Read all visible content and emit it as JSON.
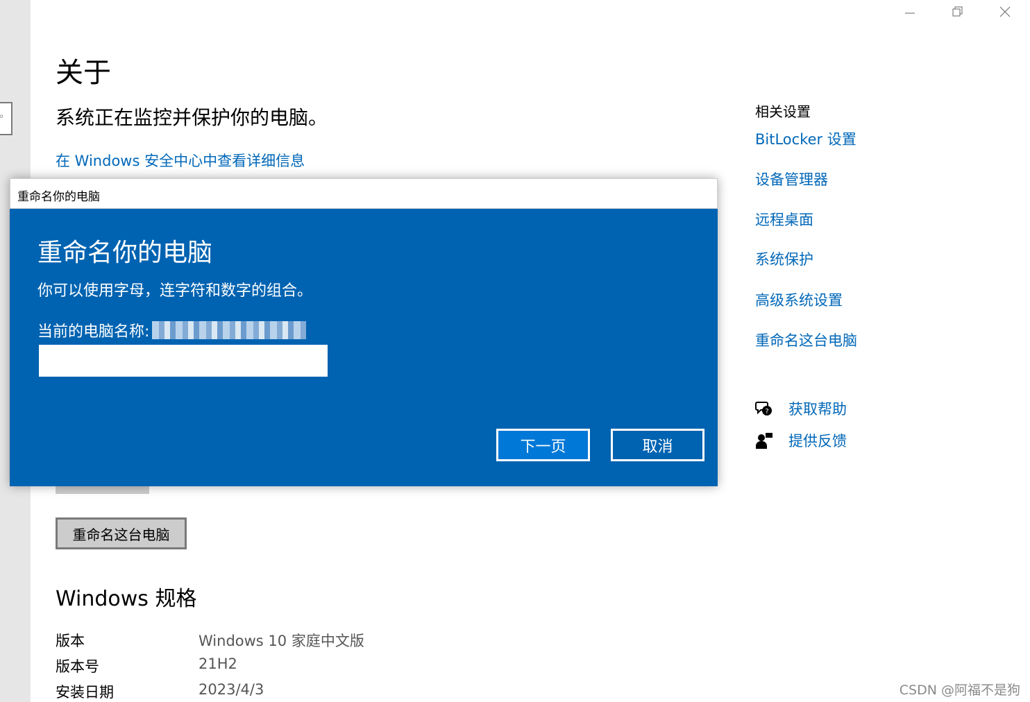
{
  "window_controls": {
    "minimize": "minimize-icon",
    "restore": "restore-icon",
    "close": "close-icon"
  },
  "page": {
    "title": "关于",
    "protect_text": "系统正在监控并保护你的电脑。",
    "security_link": "在 Windows 安全中心中查看详细信息",
    "rename_button": "重命名这台电脑"
  },
  "specs": {
    "title": "Windows 规格",
    "rows": [
      {
        "label": "版本",
        "value": "Windows 10 家庭中文版"
      },
      {
        "label": "版本号",
        "value": "21H2"
      },
      {
        "label": "安装日期",
        "value": "2023/4/3"
      }
    ]
  },
  "related": {
    "title": "相关设置",
    "links": [
      "BitLocker 设置",
      "设备管理器",
      "远程桌面",
      "系统保护",
      "高级系统设置",
      "重命名这台电脑"
    ]
  },
  "help": {
    "get_help": "获取帮助",
    "feedback": "提供反馈"
  },
  "dialog": {
    "window_title": "重命名你的电脑",
    "heading": "重命名你的电脑",
    "hint": "你可以使用字母，连字符和数字的组合。",
    "current_name_label": "当前的电脑名称:",
    "input_value": "",
    "next_button": "下一页",
    "cancel_button": "取消"
  },
  "watermark": "CSDN @阿福不是狗",
  "colors": {
    "accent": "#0067b8",
    "dialog_bg": "#0063b1",
    "primary_button": "#0078d7"
  }
}
